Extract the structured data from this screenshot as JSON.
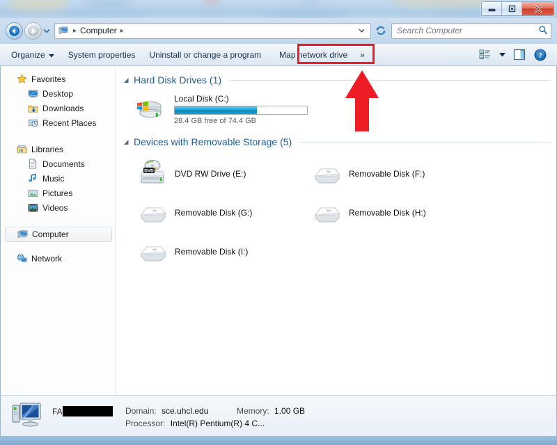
{
  "window": {
    "title": "Computer",
    "controls": [
      {
        "name": "minimize",
        "label": "Minimize"
      },
      {
        "name": "maximize",
        "label": "Maximize"
      },
      {
        "name": "close",
        "label": "Close"
      }
    ]
  },
  "nav": {
    "back_label": "Back",
    "forward_label": "Forward",
    "history_label": "Recent pages",
    "refresh_label": "Refresh",
    "breadcrumb": [
      "Computer"
    ],
    "address_dropdown_label": "Previous locations"
  },
  "search": {
    "placeholder": "Search Computer",
    "value": "",
    "icon": "search-icon"
  },
  "toolbar": {
    "items": [
      {
        "label": "Organize",
        "has_caret": true,
        "name": "organize"
      },
      {
        "label": "System properties",
        "has_caret": false,
        "name": "system-properties"
      },
      {
        "label": "Uninstall or change a program",
        "has_caret": false,
        "name": "uninstall-change-program"
      },
      {
        "label": "Map network drive",
        "has_caret": false,
        "name": "map-network-drive",
        "highlighted": true
      },
      {
        "label": "»",
        "has_caret": false,
        "name": "overflow-chevrons"
      }
    ],
    "right_buttons": [
      {
        "name": "change-view-icon",
        "label": "Change your view"
      },
      {
        "name": "view-dropdown-caret-icon",
        "label": "More options"
      },
      {
        "name": "preview-pane-icon",
        "label": "Show the preview pane"
      },
      {
        "name": "help-icon",
        "label": "Get help"
      }
    ]
  },
  "sidebar": {
    "groups": [
      {
        "root": {
          "label": "Favorites",
          "icon": "star-icon",
          "name": "sidebar-item-favorites"
        },
        "children": [
          {
            "label": "Desktop",
            "icon": "desktop-icon",
            "name": "sidebar-item-desktop"
          },
          {
            "label": "Downloads",
            "icon": "downloads-icon",
            "name": "sidebar-item-downloads"
          },
          {
            "label": "Recent Places",
            "icon": "recent-places-icon",
            "name": "sidebar-item-recent-places"
          }
        ]
      },
      {
        "root": {
          "label": "Libraries",
          "icon": "libraries-icon",
          "name": "sidebar-item-libraries"
        },
        "children": [
          {
            "label": "Documents",
            "icon": "documents-icon",
            "name": "sidebar-item-documents"
          },
          {
            "label": "Music",
            "icon": "music-icon",
            "name": "sidebar-item-music"
          },
          {
            "label": "Pictures",
            "icon": "pictures-icon",
            "name": "sidebar-item-pictures"
          },
          {
            "label": "Videos",
            "icon": "videos-icon",
            "name": "sidebar-item-videos"
          }
        ]
      },
      {
        "root": {
          "label": "Computer",
          "icon": "computer-icon",
          "name": "sidebar-item-computer",
          "selected": true
        },
        "children": []
      },
      {
        "root": {
          "label": "Network",
          "icon": "network-icon",
          "name": "sidebar-item-network"
        },
        "children": []
      }
    ]
  },
  "content": {
    "groups": [
      {
        "title": "Hard Disk Drives (1)",
        "name": "group-hard-disk-drives",
        "expanded": true,
        "drives": [
          {
            "name": "drive-local-disk-c",
            "label": "Local Disk (C:)",
            "icon": "windows-hard-drive-icon",
            "capacity_text": "28.4 GB free of 74.4 GB",
            "free_gb": 28.4,
            "total_gb": 74.4,
            "used_percent": 62
          }
        ]
      },
      {
        "title": "Devices with Removable Storage (5)",
        "name": "group-removable-storage",
        "expanded": true,
        "devices": [
          {
            "name": "drive-dvd-rw-e",
            "label": "DVD RW Drive (E:)",
            "icon": "dvd-drive-icon"
          },
          {
            "name": "drive-removable-f",
            "label": "Removable Disk (F:)",
            "icon": "removable-disk-icon"
          },
          {
            "name": "drive-removable-g",
            "label": "Removable Disk (G:)",
            "icon": "removable-disk-icon"
          },
          {
            "name": "drive-removable-h",
            "label": "Removable Disk (H:)",
            "icon": "removable-disk-icon"
          },
          {
            "name": "drive-removable-i",
            "label": "Removable Disk (I:)",
            "icon": "removable-disk-icon"
          }
        ]
      }
    ]
  },
  "status": {
    "icon": "computer-monitor-icon",
    "machine_prefix": "FA",
    "machine_redacted": true,
    "fields": [
      {
        "key": "Domain:",
        "value": "sce.uhcl.edu",
        "name": "status-domain"
      },
      {
        "key": "Memory:",
        "value": "1.00 GB",
        "name": "status-memory"
      },
      {
        "key": "Processor:",
        "value": "Intel(R) Pentium(R) 4 C...",
        "name": "status-processor"
      }
    ]
  },
  "annotation": {
    "box_target": "Map network drive",
    "arrow_direction": "up",
    "color": "#ee1c25"
  }
}
